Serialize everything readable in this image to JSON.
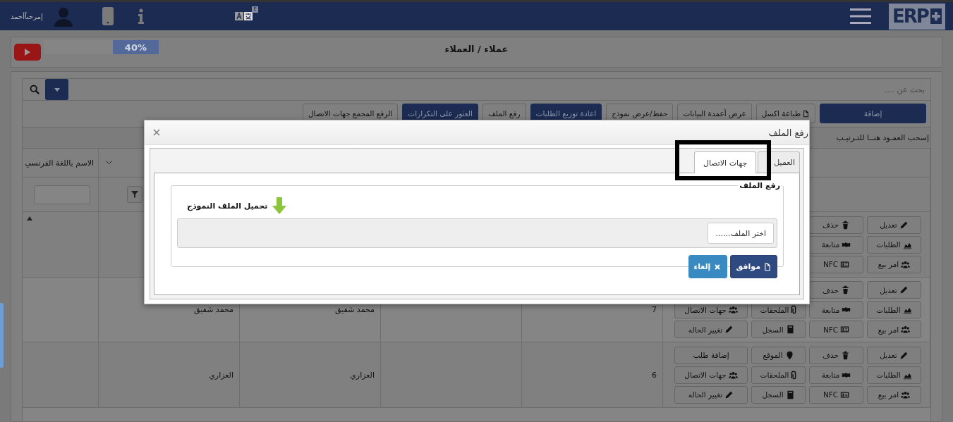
{
  "topbar": {
    "greeting": "إمرحباًأحمد",
    "language_badge": "E",
    "logo": "ERP"
  },
  "page_header": {
    "title": "عملاء / العملاء",
    "progress": {
      "level": 0.4,
      "label": "40%"
    }
  },
  "search": {
    "placeholder": "بحث عن ...."
  },
  "toolbar": [
    {
      "label": "إضافة",
      "primary": true,
      "kind": "plain"
    },
    {
      "label": "طباعة اكسل",
      "primary": false,
      "kind": "file"
    },
    {
      "label": "عرض أعمدة البيانات",
      "primary": false,
      "kind": "plain"
    },
    {
      "label": "حفظ/عرض نموذج",
      "primary": false,
      "kind": "plain"
    },
    {
      "label": "اعادة توزيع الطلبات",
      "primary": true,
      "kind": "plain"
    },
    {
      "label": "رفع الملف",
      "primary": false,
      "kind": "plain"
    },
    {
      "label": "العثور على التكرارات",
      "primary": true,
      "kind": "plain"
    },
    {
      "label": "الرفع المجمع جهات الاتصال",
      "primary": false,
      "kind": "plain"
    }
  ],
  "table": {
    "group_hint": "إسحب العمـود هنــا للتـرتيـب",
    "column_6_header": "الاسم باللغة الفرنسي",
    "rows": [
      {
        "actions": [
          [
            {
              "label": "تعديل",
              "kind": "edit"
            },
            {
              "label": "حذف",
              "kind": "delete"
            }
          ],
          [
            {
              "label": "الطلبات",
              "kind": "orders"
            },
            {
              "label": "متابعة",
              "kind": "follow"
            }
          ],
          [
            {
              "label": "امر بيع",
              "kind": "sales_order"
            },
            {
              "label": "NFC",
              "kind": "nfc"
            }
          ]
        ]
      },
      {
        "column_2": "7",
        "column_4": "محمد شفيق",
        "column_5": "محمد شفيق",
        "actions": [
          [
            {
              "label": "تعديل",
              "kind": "edit"
            },
            {
              "label": "حذف",
              "kind": "delete"
            }
          ],
          [
            {
              "label": "الطلبات",
              "kind": "orders"
            },
            {
              "label": "متابعة",
              "kind": "follow"
            },
            {
              "label": "الملحقات",
              "kind": "attachments"
            },
            {
              "label": "جهات الاتصال",
              "kind": "contacts"
            }
          ],
          [
            {
              "label": "امر بيع",
              "kind": "sales_order"
            },
            {
              "label": "NFC",
              "kind": "nfc"
            },
            {
              "label": "السجل",
              "kind": "log"
            },
            {
              "label": "تغيير الحاله",
              "kind": "status"
            }
          ]
        ]
      },
      {
        "column_2": "6",
        "column_4": "العزاري",
        "column_5": "العزاري",
        "actions": [
          [
            {
              "label": "تعديل",
              "kind": "edit"
            },
            {
              "label": "حذف",
              "kind": "delete"
            },
            {
              "label": "الموقع",
              "kind": "location"
            },
            {
              "label": "إضافة طلب",
              "kind": "add_order"
            }
          ],
          [
            {
              "label": "الطلبات",
              "kind": "orders"
            },
            {
              "label": "متابعة",
              "kind": "follow"
            },
            {
              "label": "الملحقات",
              "kind": "attachments"
            },
            {
              "label": "جهات الاتصال",
              "kind": "contacts"
            }
          ],
          [
            {
              "label": "امر بيع",
              "kind": "sales_order"
            },
            {
              "label": "NFC",
              "kind": "nfc"
            },
            {
              "label": "السجل",
              "kind": "log"
            },
            {
              "label": "تغيير الحاله",
              "kind": "status"
            }
          ]
        ]
      }
    ]
  },
  "modal": {
    "title": "رفع الملف",
    "tabs": [
      {
        "label": "العميل",
        "selected": false
      },
      {
        "label": "جهات الاتصال",
        "selected": true
      }
    ],
    "legend": "رفع الملف",
    "template_link": "تحميل الملف النموذج",
    "file_button": "اختر الملف......",
    "buttons": [
      {
        "label": "موافق",
        "kind": "ok"
      },
      {
        "label": "إلغاء",
        "kind": "cancel"
      }
    ]
  }
}
